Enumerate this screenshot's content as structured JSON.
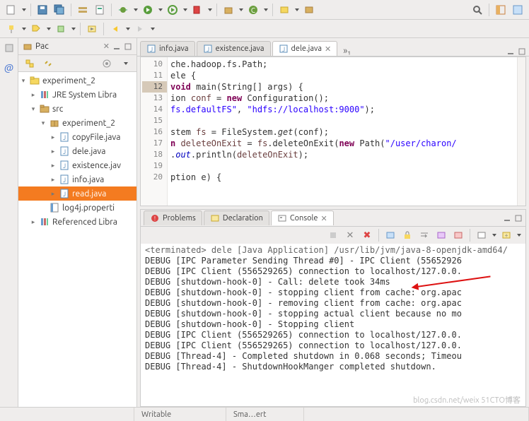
{
  "toolbar1": {
    "search_icon": "🔍"
  },
  "package_explorer": {
    "title": "Pac",
    "tree": [
      {
        "label": "experiment_2",
        "depth": 0,
        "expanded": true,
        "icon": "project",
        "arrow": "▾"
      },
      {
        "label": "JRE System Libra",
        "depth": 1,
        "expanded": false,
        "icon": "lib",
        "arrow": "▸"
      },
      {
        "label": "src",
        "depth": 1,
        "expanded": true,
        "icon": "src",
        "arrow": "▾"
      },
      {
        "label": "experiment_2",
        "depth": 2,
        "expanded": true,
        "icon": "package",
        "arrow": "▾"
      },
      {
        "label": "copyFile.java",
        "depth": 3,
        "expanded": false,
        "icon": "java",
        "arrow": "▸"
      },
      {
        "label": "dele.java",
        "depth": 3,
        "expanded": false,
        "icon": "java",
        "arrow": "▸"
      },
      {
        "label": "existence.jav",
        "depth": 3,
        "expanded": false,
        "icon": "java",
        "arrow": "▸"
      },
      {
        "label": "info.java",
        "depth": 3,
        "expanded": false,
        "icon": "java",
        "arrow": "▸"
      },
      {
        "label": "read.java",
        "depth": 3,
        "expanded": false,
        "icon": "java",
        "arrow": "▸",
        "selected": true
      },
      {
        "label": "log4j.properti",
        "depth": 2,
        "expanded": false,
        "icon": "file",
        "arrow": ""
      },
      {
        "label": "Referenced Libra",
        "depth": 1,
        "expanded": false,
        "icon": "lib",
        "arrow": "▸"
      }
    ]
  },
  "editor": {
    "tabs": [
      {
        "label": "info.java",
        "active": false
      },
      {
        "label": "existence.java",
        "active": false
      },
      {
        "label": "dele.java",
        "active": true,
        "dirty": false
      }
    ],
    "overflow_indicator": "»₁",
    "lines": {
      "l10": "che.hadoop.fs.Path;",
      "l11": "ele {",
      "l12_pre": "void",
      "l12_post": " main(String[] args) {",
      "l13_a": "ion ",
      "l13_b": "conf",
      "l13_c": " = ",
      "l13_d": "new",
      "l13_e": " Configuration();",
      "l14_a": "fs.defaultFS\"",
      "l14_b": ", ",
      "l14_c": "\"hdfs://localhost:9000\"",
      "l14_d": ");",
      "l15": "",
      "l16_a": "stem ",
      "l16_b": "fs",
      "l16_c": " = FileSystem.",
      "l16_d": "get",
      "l16_e": "(conf);",
      "l17_a": "n ",
      "l17_b": "deleteOnExit",
      "l17_c": " = ",
      "l17_d": "fs",
      "l17_e": ".deleteOnExit(",
      "l17_f": "new",
      "l17_g": " Path(",
      "l17_h": "\"/user/charon/",
      "l18_a": ".",
      "l18_b": "out",
      "l18_c": ".println(",
      "l18_d": "deleteOnExit",
      "l18_e": ");",
      "l19": "",
      "l20": "ption e) {"
    },
    "gutter": [
      "10",
      "11",
      "12",
      "13",
      "14",
      "15",
      "16",
      "17",
      "18",
      "19",
      "20"
    ]
  },
  "bottom": {
    "tabs": [
      {
        "label": "Problems",
        "active": false,
        "icon": "problems"
      },
      {
        "label": "Declaration",
        "active": false,
        "icon": "declaration"
      },
      {
        "label": "Console",
        "active": true,
        "icon": "console"
      }
    ],
    "console_header": "<terminated> dele [Java Application] /usr/lib/jvm/java-8-openjdk-amd64/",
    "console_lines": [
      "DEBUG [IPC Parameter Sending Thread #0] - IPC Client (55652926",
      "DEBUG [IPC Client (556529265) connection to localhost/127.0.0.",
      "DEBUG [shutdown-hook-0] - Call: delete took 34ms",
      "DEBUG [shutdown-hook-0] - stopping client from cache: org.apac",
      "DEBUG [shutdown-hook-0] - removing client from cache: org.apac",
      "DEBUG [shutdown-hook-0] - stopping actual client because no mo",
      "DEBUG [shutdown-hook-0] - Stopping client",
      "DEBUG [IPC Client (556529265) connection to localhost/127.0.0.",
      "DEBUG [IPC Client (556529265) connection to localhost/127.0.0.",
      "DEBUG [Thread-4] - Completed shutdown in 0.068 seconds; Timeou",
      "DEBUG [Thread-4] - ShutdownHookManger completed shutdown."
    ]
  },
  "statusbar": {
    "writable": "Writable",
    "smart": "Sma…ert"
  },
  "watermark": "blog.csdn.net/weix   51CTO博客"
}
